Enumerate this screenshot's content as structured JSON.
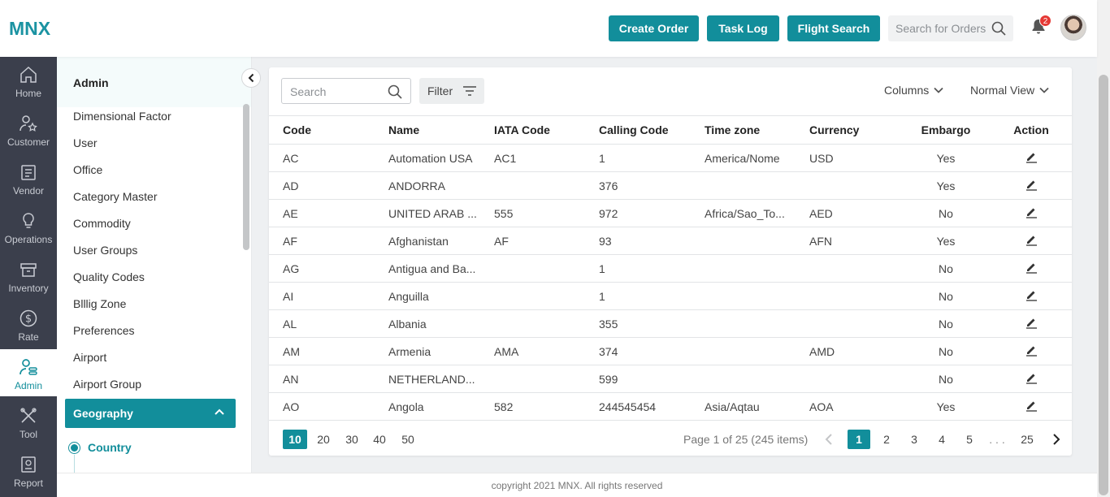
{
  "app": {
    "logo": "MNX"
  },
  "header": {
    "buttons": [
      "Create Order",
      "Task Log",
      "Flight Search"
    ],
    "search_placeholder": "Search for Orders",
    "notification_count": "2"
  },
  "rail": [
    {
      "label": "Home",
      "icon": "home-icon"
    },
    {
      "label": "Customer",
      "icon": "customer-icon"
    },
    {
      "label": "Vendor",
      "icon": "vendor-icon"
    },
    {
      "label": "Operations",
      "icon": "bulb-icon"
    },
    {
      "label": "Inventory",
      "icon": "box-icon"
    },
    {
      "label": "Rate",
      "icon": "dollar-icon"
    },
    {
      "label": "Admin",
      "icon": "admin-icon",
      "active": true
    },
    {
      "label": "Tool",
      "icon": "tools-icon"
    },
    {
      "label": "Report",
      "icon": "report-icon"
    }
  ],
  "side": {
    "title": "Admin",
    "items": [
      "Dimensional Factor",
      "User",
      "Office",
      "Category Master",
      "Commodity",
      "User Groups",
      "Quality Codes",
      "Blllig Zone",
      "Preferences",
      "Airport",
      "Airport Group"
    ],
    "group": "Geography",
    "active_child": "Country"
  },
  "toolbar": {
    "search_placeholder": "Search",
    "filter": "Filter",
    "columns": "Columns",
    "view": "Normal View"
  },
  "table": {
    "headers": [
      "Code",
      "Name",
      "IATA Code",
      "Calling Code",
      "Time zone",
      "Currency",
      "Embargo",
      "Action"
    ],
    "rows": [
      [
        "AC",
        "Automation USA",
        "AC1",
        "1",
        "America/Nome",
        "USD",
        "Yes"
      ],
      [
        "AD",
        "ANDORRA",
        "",
        "376",
        "",
        "",
        "Yes"
      ],
      [
        "AE",
        "UNITED ARAB ...",
        "555",
        "972",
        "Africa/Sao_To...",
        "AED",
        "No"
      ],
      [
        "AF",
        "Afghanistan",
        "AF",
        "93",
        "",
        "AFN",
        "Yes"
      ],
      [
        "AG",
        "Antigua and Ba...",
        "",
        "1",
        "",
        "",
        "No"
      ],
      [
        "AI",
        "Anguilla",
        "",
        "1",
        "",
        "",
        "No"
      ],
      [
        "AL",
        "Albania",
        "",
        "355",
        "",
        "",
        "No"
      ],
      [
        "AM",
        "Armenia",
        "AMA",
        "374",
        "",
        "AMD",
        "No"
      ],
      [
        "AN",
        "NETHERLAND...",
        "",
        "599",
        "",
        "",
        "No"
      ],
      [
        "AO",
        "Angola",
        "582",
        "244545454",
        "Asia/Aqtau",
        "AOA",
        "Yes"
      ]
    ]
  },
  "pager": {
    "sizes": [
      "10",
      "20",
      "30",
      "40",
      "50"
    ],
    "info": "Page 1 of 25 (245 items)",
    "pages": [
      "1",
      "2",
      "3",
      "4",
      "5",
      ". . .",
      "25"
    ]
  },
  "footer": "copyright 2021 MNX. All rights reserved",
  "colors": {
    "accent": "#128e9b",
    "rail": "#3b3f4c"
  }
}
